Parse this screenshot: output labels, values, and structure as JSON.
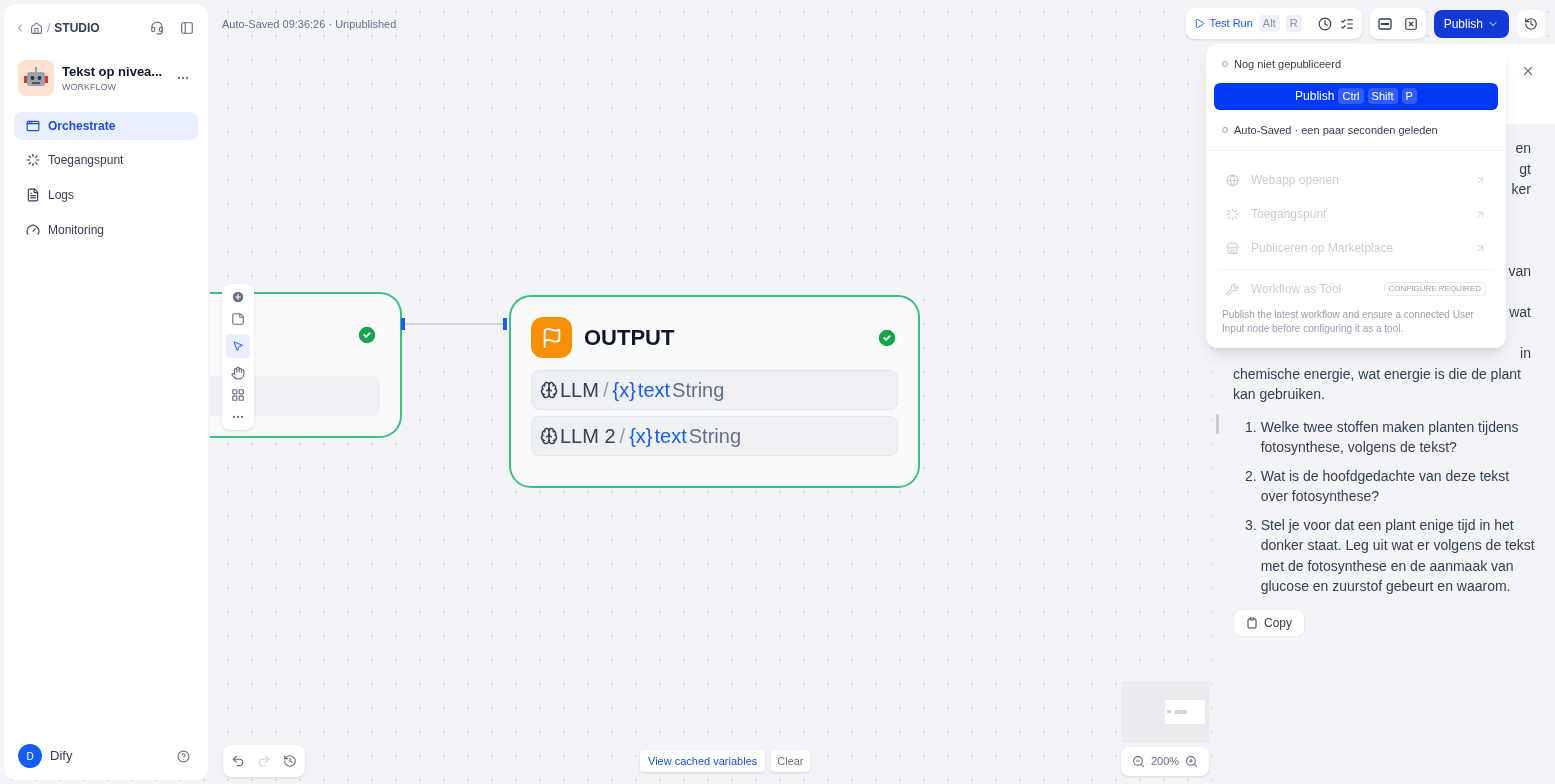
{
  "sidebar": {
    "breadcrumb_separator": "/",
    "breadcrumb": "STUDIO",
    "app": {
      "name": "Tekst op nivea...",
      "type": "WORKFLOW"
    },
    "nav": [
      {
        "kind": "orchestrate",
        "label": "Orchestrate",
        "selected": true
      },
      {
        "kind": "entry",
        "label": "Toegangspunt",
        "selected": false
      },
      {
        "kind": "logs",
        "label": "Logs",
        "selected": false
      },
      {
        "kind": "monitoring",
        "label": "Monitoring",
        "selected": false
      }
    ],
    "user": {
      "initial": "D",
      "name": "Dify"
    }
  },
  "header": {
    "status": "Auto-Saved 09:36:26 · Unpublished"
  },
  "toolbar": {
    "test_run": {
      "label": "Test Run",
      "keys": [
        "Alt",
        "R"
      ]
    },
    "publish": "Publish"
  },
  "publish_menu": {
    "status": "Nog niet gepubliceerd",
    "publish_button": {
      "label": "Publish",
      "keys": [
        "Ctrl",
        "Shift",
        "P"
      ]
    },
    "autosave": "Auto-Saved · een paar seconden geleden",
    "items": [
      {
        "kind": "webapp",
        "label": "Webapp openen",
        "disabled": true
      },
      {
        "kind": "entry",
        "label": "Toegangspunt",
        "disabled": true
      },
      {
        "kind": "marketplace",
        "label": "Publiceren op Marketplace",
        "disabled": true
      }
    ],
    "tool": {
      "label": "Workflow as Tool",
      "badge": "CONFIGURE REQUIRED",
      "disabled": true
    },
    "note": "Publish the latest workflow and ensure a connected User Input node before configuring it as a tool."
  },
  "canvas": {
    "output_node": {
      "title": "OUTPUT",
      "variables": [
        {
          "node": "LLM",
          "separator": "/",
          "marker": "{x}",
          "name": "text",
          "type": "String"
        },
        {
          "node": "LLM 2",
          "separator": "/",
          "marker": "{x}",
          "name": "text",
          "type": "String"
        }
      ]
    },
    "cache": {
      "view": "View cached variables",
      "clear": "Clear"
    },
    "zoom": "200%"
  },
  "result": {
    "fragments": [
      [
        "en",
        "gt",
        "ker"
      ],
      [
        "van"
      ],
      [
        "wat"
      ],
      [
        "in"
      ]
    ],
    "paragraph": "chemische energie, wat energie is die de plant kan gebruiken.",
    "questions": [
      {
        "number": "1.",
        "text": "Welke twee stoffen maken planten tijdens fotosynthese, volgens de tekst?"
      },
      {
        "number": "2.",
        "text": "Wat is de hoofdgedachte van deze tekst over fotosynthese?"
      },
      {
        "number": "3.",
        "text": "Stel je voor dat een plant enige tijd in het donker staat. Leg uit wat er volgens de tekst met de fotosynthese en de aanmaak van glucose en zuurstof gebeurt en waarom."
      }
    ],
    "copy": "Copy"
  }
}
